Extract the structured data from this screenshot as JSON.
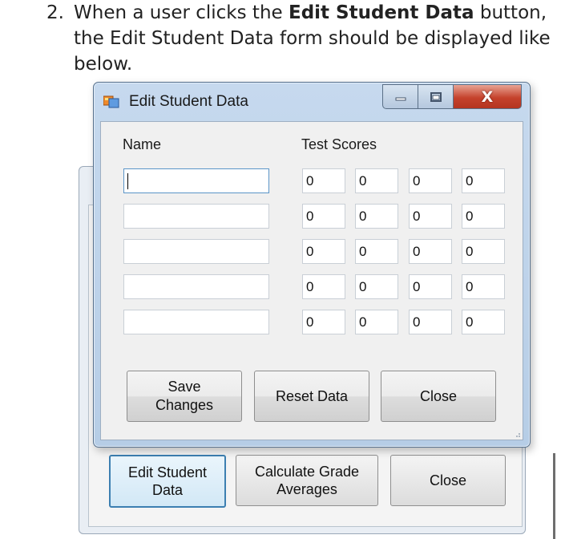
{
  "instruction": {
    "number": "2.",
    "text_1": "When a user clicks the ",
    "bold": "Edit Student Data",
    "text_2": " button, the Edit Student Data form should be displayed like below."
  },
  "main_form": {
    "buttons": {
      "edit_line1": "Edit Student",
      "edit_line2": "Data",
      "calc_line1": "Calculate Grade",
      "calc_line2": "Averages",
      "close": "Close"
    }
  },
  "dialog": {
    "title": "Edit Student Data",
    "caption_close": "X",
    "name_header": "Name",
    "scores_header": "Test Scores",
    "rows": [
      {
        "name": "",
        "scores": [
          "0",
          "0",
          "0",
          "0"
        ]
      },
      {
        "name": "",
        "scores": [
          "0",
          "0",
          "0",
          "0"
        ]
      },
      {
        "name": "",
        "scores": [
          "0",
          "0",
          "0",
          "0"
        ]
      },
      {
        "name": "",
        "scores": [
          "0",
          "0",
          "0",
          "0"
        ]
      },
      {
        "name": "",
        "scores": [
          "0",
          "0",
          "0",
          "0"
        ]
      }
    ],
    "buttons": {
      "save_line1": "Save",
      "save_line2": "Changes",
      "reset": "Reset Data",
      "close": "Close"
    }
  },
  "icons": {
    "app": "form-app-icon",
    "minimize": "minimize-icon",
    "maximize": "maximize-icon",
    "close": "close-icon"
  }
}
